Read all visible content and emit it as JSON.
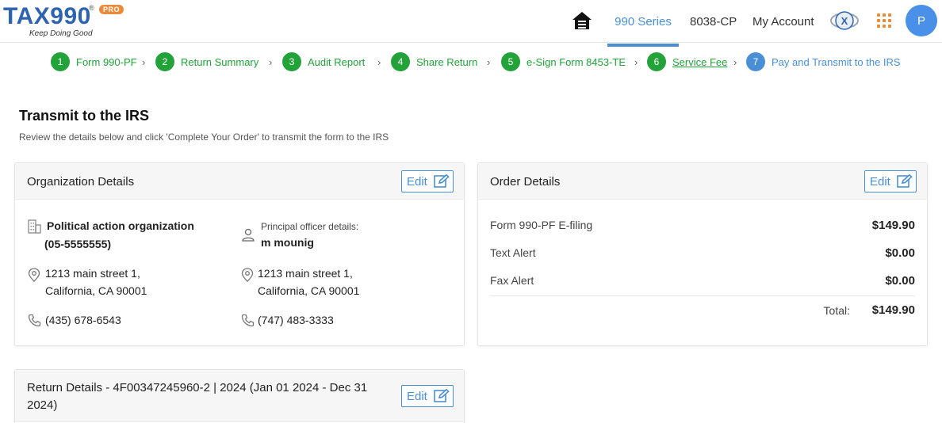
{
  "brand": {
    "name": "TAX990",
    "registered": "®",
    "badge": "PRO",
    "tagline": "Keep Doing Good"
  },
  "nav": {
    "series": "990 Series",
    "cp": "8038-CP",
    "account": "My Account",
    "avatar_initial": "P"
  },
  "steps": [
    {
      "num": "1",
      "label": "Form 990-PF"
    },
    {
      "num": "2",
      "label": "Return Summary"
    },
    {
      "num": "3",
      "label": "Audit Report"
    },
    {
      "num": "4",
      "label": "Share Return"
    },
    {
      "num": "5",
      "label": "e-Sign Form 8453-TE"
    },
    {
      "num": "6",
      "label": "Service Fee"
    },
    {
      "num": "7",
      "label": "Pay and Transmit to the IRS"
    }
  ],
  "page": {
    "title": "Transmit to the IRS",
    "subtitle": "Review the details below and click 'Complete Your Order' to transmit the form to the IRS"
  },
  "org_card": {
    "title": "Organization Details",
    "edit": "Edit",
    "org_name": "Political action organization",
    "ein": "(05-5555555)",
    "officer_label": "Principal officer details:",
    "officer_name": "m mounig",
    "org_address_1": "1213 main street 1,",
    "org_address_2": "California, CA 90001",
    "officer_address_1": "1213 main street 1,",
    "officer_address_2": "California, CA 90001",
    "org_phone": "(435) 678-6543",
    "officer_phone": "(747) 483-3333"
  },
  "order_card": {
    "title": "Order Details",
    "edit": "Edit",
    "items": [
      {
        "label": "Form 990-PF E-filing",
        "value": "$149.90"
      },
      {
        "label": "Text Alert",
        "value": "$0.00"
      },
      {
        "label": "Fax Alert",
        "value": "$0.00"
      }
    ],
    "total_label": "Total:",
    "total_value": "$149.90"
  },
  "return_card": {
    "title": "Return Details - 4F00347245960-2 | 2024 (Jan 01 2024 - Dec 31 2024)",
    "edit": "Edit"
  },
  "colors": {
    "brand_blue": "#2e63b0",
    "accent_blue": "#4a8fd6",
    "step_green": "#23a23a",
    "pro_orange": "#e98b3a"
  }
}
